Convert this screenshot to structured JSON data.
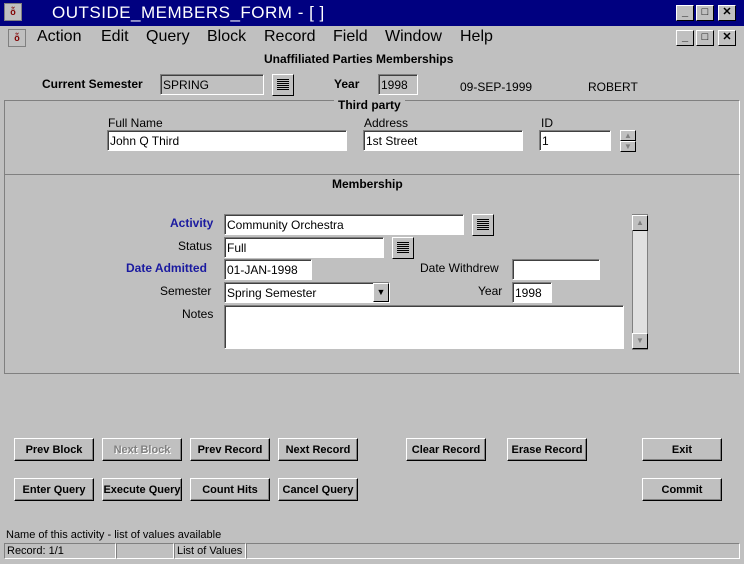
{
  "window": {
    "title": "OUTSIDE_MEMBERS_FORM - [ ]",
    "minimize": "_",
    "maximize": "□",
    "close": "✕",
    "restore": "🗗"
  },
  "menu": {
    "items": [
      "Action",
      "Edit",
      "Query",
      "Block",
      "Record",
      "Field",
      "Window",
      "Help"
    ]
  },
  "form": {
    "heading": "Unaffiliated Parties Memberships",
    "current_semester_label": "Current Semester",
    "current_semester_value": "SPRING",
    "year_label": "Year",
    "year_value": "1998",
    "date": "09-SEP-1999",
    "user": "ROBERT"
  },
  "third_party": {
    "title": "Third party",
    "full_name_label": "Full Name",
    "full_name_value": "John Q Third",
    "address_label": "Address",
    "address_value": "1st Street",
    "id_label": "ID",
    "id_value": "1"
  },
  "membership": {
    "title": "Membership",
    "activity_label": "Activity",
    "activity_value": "Community Orchestra",
    "status_label": "Status",
    "status_value": "Full",
    "date_admitted_label": "Date Admitted",
    "date_admitted_value": "01-JAN-1998",
    "date_withdrew_label": "Date Withdrew",
    "date_withdrew_value": "",
    "semester_label": "Semester",
    "semester_value": "Spring Semester",
    "year_label": "Year",
    "year_value": "1998",
    "notes_label": "Notes",
    "notes_value": ""
  },
  "buttons": {
    "prev_block": "Prev Block",
    "next_block": "Next Block",
    "prev_record": "Prev Record",
    "next_record": "Next Record",
    "clear_record": "Clear Record",
    "erase_record": "Erase Record",
    "exit": "Exit",
    "enter_query": "Enter Query",
    "execute_query": "Execute Query",
    "count_hits": "Count Hits",
    "cancel_query": "Cancel Query",
    "commit": "Commit"
  },
  "statusbar": {
    "hint": "Name of this activity - list of values available",
    "record": "Record: 1/1",
    "lov": "List of Values"
  }
}
